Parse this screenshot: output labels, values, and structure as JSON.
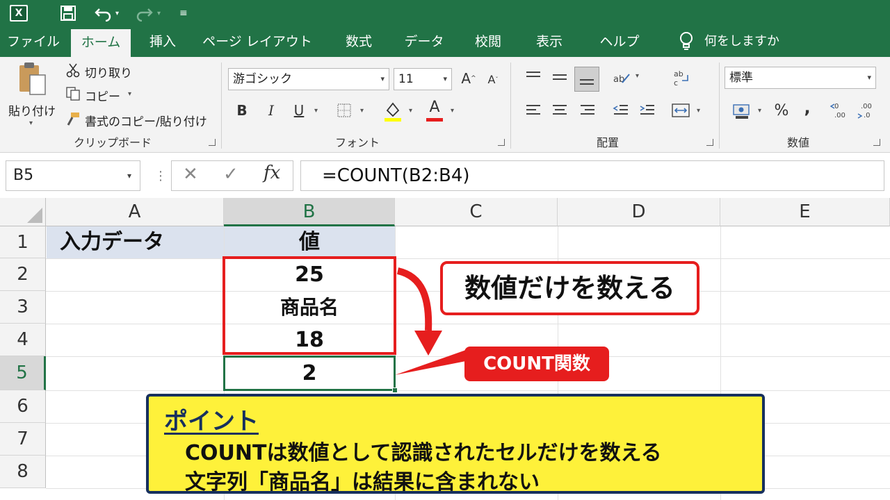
{
  "titlebar": {
    "app_icon_letter": "X"
  },
  "tabs": [
    {
      "label": "ファイル"
    },
    {
      "label": "ホーム"
    },
    {
      "label": "挿入"
    },
    {
      "label": "ページ レイアウト"
    },
    {
      "label": "数式"
    },
    {
      "label": "データ"
    },
    {
      "label": "校閲"
    },
    {
      "label": "表示"
    },
    {
      "label": "ヘルプ"
    }
  ],
  "tell_me": "何をしますか",
  "ribbon": {
    "clipboard": {
      "paste": "貼り付け",
      "cut": "切り取り",
      "copy": "コピー",
      "format_painter": "書式のコピー/貼り付け",
      "label": "クリップボード"
    },
    "font": {
      "font_name": "游ゴシック",
      "font_size": "11",
      "bold": "B",
      "italic": "I",
      "underline": "U",
      "font_color_letter": "A",
      "grow_letter": "A",
      "shrink_letter": "A",
      "label": "フォント",
      "fill_color": "#ffff00",
      "text_color": "#e61e1e"
    },
    "alignment": {
      "label": "配置"
    },
    "number": {
      "format": "標準",
      "percent": "%",
      "comma": ",",
      "label": "数値"
    }
  },
  "formula_bar": {
    "name_box": "B5",
    "cancel": "✕",
    "enter": "✓",
    "fx": "fx",
    "formula": "=COUNT(B2:B4)"
  },
  "sheet": {
    "columns": [
      "A",
      "B",
      "C",
      "D",
      "E"
    ],
    "rows": [
      "1",
      "2",
      "3",
      "4",
      "5",
      "6",
      "7",
      "8"
    ],
    "cells": {
      "A1": "入力データ",
      "B1": "値",
      "B2": "25",
      "B3": "商品名",
      "B4": "18",
      "B5": "2"
    }
  },
  "annotations": {
    "callout_main": "数値だけを数える",
    "callout_function": "COUNT関数",
    "point_title": "ポイント",
    "point_line1": "COUNTは数値として認識されたセルだけを数える",
    "point_line2": "文字列「商品名」は結果に含まれない",
    "highlight_color": "#e61e1e",
    "point_bg": "#fef13a",
    "accent": "#217346"
  }
}
